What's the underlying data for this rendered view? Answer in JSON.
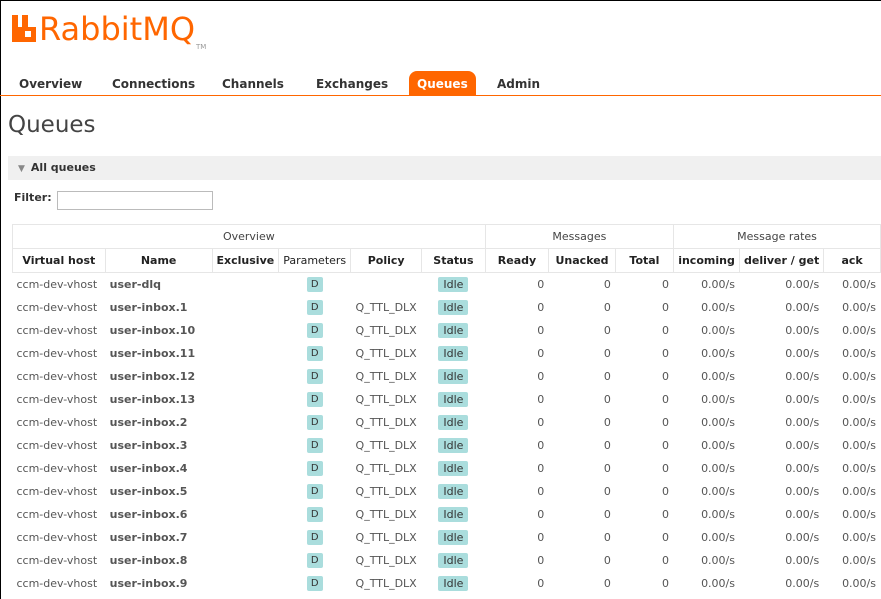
{
  "app": {
    "logo_text": "RabbitMQ",
    "logo_tm": "TM",
    "accent": "#ff6600",
    "badge_color": "#aadddd"
  },
  "tabs": [
    {
      "label": "Overview",
      "active": false
    },
    {
      "label": "Connections",
      "active": false
    },
    {
      "label": "Channels",
      "active": false
    },
    {
      "label": "Exchanges",
      "active": false
    },
    {
      "label": "Queues",
      "active": true
    },
    {
      "label": "Admin",
      "active": false
    }
  ],
  "page": {
    "title": "Queues",
    "section": "All queues",
    "filter_label": "Filter:",
    "filter_value": ""
  },
  "table": {
    "groups": {
      "overview": "Overview",
      "messages": "Messages",
      "rates": "Message rates"
    },
    "columns": [
      "Virtual host",
      "Name",
      "Exclusive",
      "Parameters",
      "Policy",
      "Status",
      "Ready",
      "Unacked",
      "Total",
      "incoming",
      "deliver / get",
      "ack"
    ],
    "rows": [
      {
        "vhost": "ccm-dev-vhost",
        "name": "user-dlq",
        "exclusive": "",
        "params": "D",
        "policy": "",
        "status": "Idle",
        "ready": "0",
        "unacked": "0",
        "total": "0",
        "incoming": "0.00/s",
        "deliver": "0.00/s",
        "ack": "0.00/s"
      },
      {
        "vhost": "ccm-dev-vhost",
        "name": "user-inbox.1",
        "exclusive": "",
        "params": "D",
        "policy": "Q_TTL_DLX",
        "status": "Idle",
        "ready": "0",
        "unacked": "0",
        "total": "0",
        "incoming": "0.00/s",
        "deliver": "0.00/s",
        "ack": "0.00/s"
      },
      {
        "vhost": "ccm-dev-vhost",
        "name": "user-inbox.10",
        "exclusive": "",
        "params": "D",
        "policy": "Q_TTL_DLX",
        "status": "Idle",
        "ready": "0",
        "unacked": "0",
        "total": "0",
        "incoming": "0.00/s",
        "deliver": "0.00/s",
        "ack": "0.00/s"
      },
      {
        "vhost": "ccm-dev-vhost",
        "name": "user-inbox.11",
        "exclusive": "",
        "params": "D",
        "policy": "Q_TTL_DLX",
        "status": "Idle",
        "ready": "0",
        "unacked": "0",
        "total": "0",
        "incoming": "0.00/s",
        "deliver": "0.00/s",
        "ack": "0.00/s"
      },
      {
        "vhost": "ccm-dev-vhost",
        "name": "user-inbox.12",
        "exclusive": "",
        "params": "D",
        "policy": "Q_TTL_DLX",
        "status": "Idle",
        "ready": "0",
        "unacked": "0",
        "total": "0",
        "incoming": "0.00/s",
        "deliver": "0.00/s",
        "ack": "0.00/s"
      },
      {
        "vhost": "ccm-dev-vhost",
        "name": "user-inbox.13",
        "exclusive": "",
        "params": "D",
        "policy": "Q_TTL_DLX",
        "status": "Idle",
        "ready": "0",
        "unacked": "0",
        "total": "0",
        "incoming": "0.00/s",
        "deliver": "0.00/s",
        "ack": "0.00/s"
      },
      {
        "vhost": "ccm-dev-vhost",
        "name": "user-inbox.2",
        "exclusive": "",
        "params": "D",
        "policy": "Q_TTL_DLX",
        "status": "Idle",
        "ready": "0",
        "unacked": "0",
        "total": "0",
        "incoming": "0.00/s",
        "deliver": "0.00/s",
        "ack": "0.00/s"
      },
      {
        "vhost": "ccm-dev-vhost",
        "name": "user-inbox.3",
        "exclusive": "",
        "params": "D",
        "policy": "Q_TTL_DLX",
        "status": "Idle",
        "ready": "0",
        "unacked": "0",
        "total": "0",
        "incoming": "0.00/s",
        "deliver": "0.00/s",
        "ack": "0.00/s"
      },
      {
        "vhost": "ccm-dev-vhost",
        "name": "user-inbox.4",
        "exclusive": "",
        "params": "D",
        "policy": "Q_TTL_DLX",
        "status": "Idle",
        "ready": "0",
        "unacked": "0",
        "total": "0",
        "incoming": "0.00/s",
        "deliver": "0.00/s",
        "ack": "0.00/s"
      },
      {
        "vhost": "ccm-dev-vhost",
        "name": "user-inbox.5",
        "exclusive": "",
        "params": "D",
        "policy": "Q_TTL_DLX",
        "status": "Idle",
        "ready": "0",
        "unacked": "0",
        "total": "0",
        "incoming": "0.00/s",
        "deliver": "0.00/s",
        "ack": "0.00/s"
      },
      {
        "vhost": "ccm-dev-vhost",
        "name": "user-inbox.6",
        "exclusive": "",
        "params": "D",
        "policy": "Q_TTL_DLX",
        "status": "Idle",
        "ready": "0",
        "unacked": "0",
        "total": "0",
        "incoming": "0.00/s",
        "deliver": "0.00/s",
        "ack": "0.00/s"
      },
      {
        "vhost": "ccm-dev-vhost",
        "name": "user-inbox.7",
        "exclusive": "",
        "params": "D",
        "policy": "Q_TTL_DLX",
        "status": "Idle",
        "ready": "0",
        "unacked": "0",
        "total": "0",
        "incoming": "0.00/s",
        "deliver": "0.00/s",
        "ack": "0.00/s"
      },
      {
        "vhost": "ccm-dev-vhost",
        "name": "user-inbox.8",
        "exclusive": "",
        "params": "D",
        "policy": "Q_TTL_DLX",
        "status": "Idle",
        "ready": "0",
        "unacked": "0",
        "total": "0",
        "incoming": "0.00/s",
        "deliver": "0.00/s",
        "ack": "0.00/s"
      },
      {
        "vhost": "ccm-dev-vhost",
        "name": "user-inbox.9",
        "exclusive": "",
        "params": "D",
        "policy": "Q_TTL_DLX",
        "status": "Idle",
        "ready": "0",
        "unacked": "0",
        "total": "0",
        "incoming": "0.00/s",
        "deliver": "0.00/s",
        "ack": "0.00/s"
      }
    ]
  }
}
